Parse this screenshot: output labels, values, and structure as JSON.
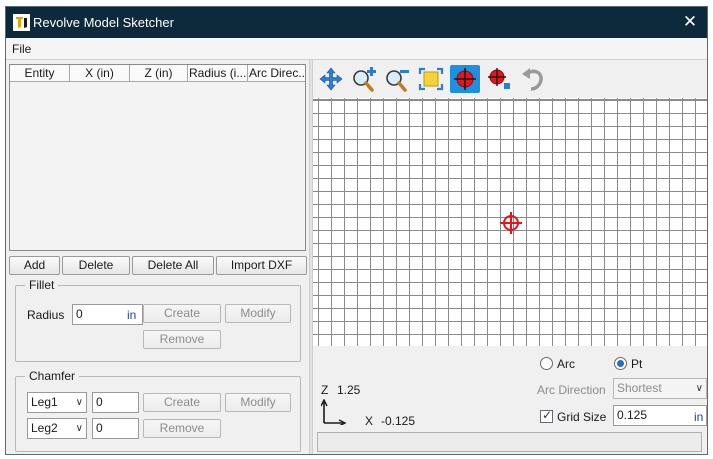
{
  "window": {
    "title": "Revolve Model Sketcher",
    "close_glyph": "✕",
    "icon": "revolve-app-icon"
  },
  "menu": {
    "file": "File"
  },
  "table": {
    "columns": [
      "Entity",
      "X (in)",
      "Z (in)",
      "Radius (i...",
      "Arc Direc..."
    ],
    "rows": []
  },
  "table_buttons": {
    "add": "Add",
    "delete": "Delete",
    "delete_all": "Delete All",
    "import_dxf": "Import DXF"
  },
  "fillet": {
    "title": "Fillet",
    "radius_label": "Radius",
    "radius_value": "0",
    "radius_unit": "in",
    "create": "Create",
    "modify": "Modify",
    "remove": "Remove"
  },
  "chamfer": {
    "title": "Chamfer",
    "leg1_option": "Leg1",
    "leg1_value": "0",
    "leg2_option": "Leg2",
    "leg2_value": "0",
    "create": "Create",
    "modify": "Modify",
    "remove": "Remove"
  },
  "toolbar": {
    "tools": [
      "pan-icon",
      "zoom-in-icon",
      "zoom-out-icon",
      "zoom-fit-icon",
      "set-origin-icon",
      "move-origin-icon",
      "undo-icon"
    ],
    "active_tool": "set-origin-icon"
  },
  "mode": {
    "arc_label": "Arc",
    "pt_label": "Pt",
    "selected": "Pt"
  },
  "arc_direction": {
    "label": "Arc Direction",
    "value": "Shortest"
  },
  "grid": {
    "label": "Grid Size",
    "checked": true,
    "value": "0.125",
    "unit": "in"
  },
  "coords": {
    "z_label": "Z",
    "z_value": "1.25",
    "x_label": "X",
    "x_value": "-0.125"
  },
  "colors": {
    "titlebar": "#0c2a3c",
    "accent": "#1e90e0",
    "origin_marker": "#e8141c",
    "unit_text": "#1f3fb0"
  }
}
